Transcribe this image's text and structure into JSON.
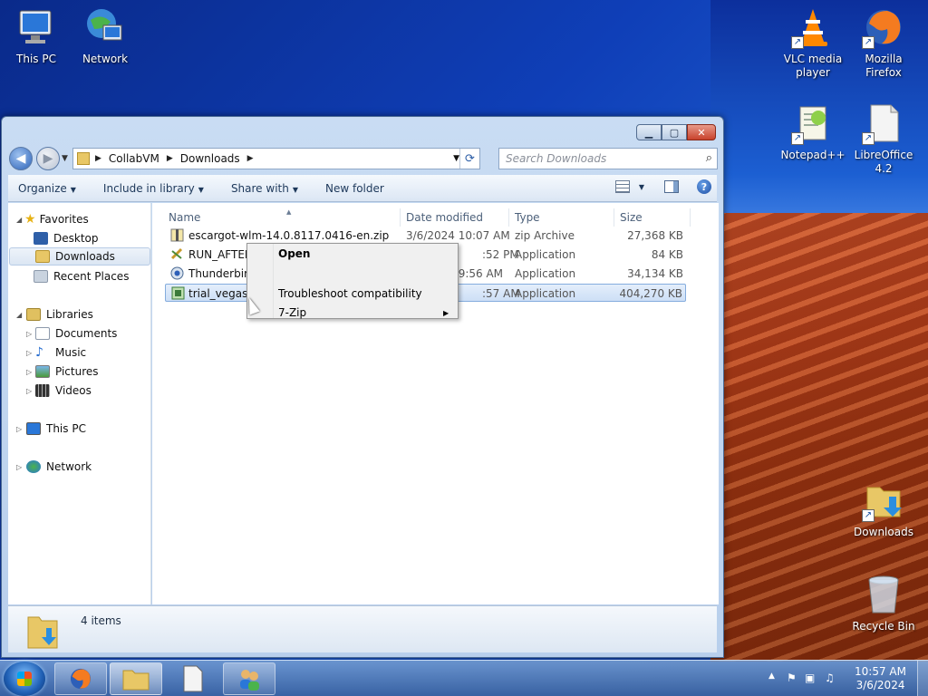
{
  "desktop": {
    "icons_left": [
      {
        "label": "This PC",
        "icon": "computer-icon"
      },
      {
        "label": "Network",
        "icon": "network-globe-icon"
      }
    ],
    "icons_right": [
      {
        "label": "VLC media player",
        "icon": "vlc-cone-icon"
      },
      {
        "label": "Mozilla Firefox",
        "icon": "firefox-icon"
      },
      {
        "label": "Notepad++",
        "icon": "notepadpp-icon"
      },
      {
        "label": "LibreOffice 4.2",
        "icon": "libreoffice-icon"
      },
      {
        "label": "Downloads",
        "icon": "downloads-folder-icon"
      },
      {
        "label": "Recycle Bin",
        "icon": "recycle-bin-icon"
      }
    ]
  },
  "window": {
    "address": {
      "segments": [
        "CollabVM",
        "Downloads"
      ]
    },
    "search_placeholder": "Search Downloads",
    "toolbar": {
      "organize": "Organize",
      "include_in_library": "Include in library",
      "share_with": "Share with",
      "new_folder": "New folder"
    },
    "nav": {
      "favorites": "Favorites",
      "desktop": "Desktop",
      "downloads": "Downloads",
      "recent_places": "Recent Places",
      "libraries": "Libraries",
      "documents": "Documents",
      "music": "Music",
      "pictures": "Pictures",
      "videos": "Videos",
      "this_pc": "This PC",
      "network": "Network"
    },
    "columns": {
      "name": "Name",
      "date": "Date modified",
      "type": "Type",
      "size": "Size"
    },
    "files": [
      {
        "name": "escargot-wlm-14.0.8117.0416-en.zip",
        "date": "3/6/2024 10:07 AM",
        "type": "zip Archive",
        "size": "27,368 KB"
      },
      {
        "name": "RUN_AFTER_",
        "date": ":52 PM",
        "type": "Application",
        "size": "84 KB"
      },
      {
        "name": "Thunderbird Setup 45.0.exe",
        "date": "3/6/2024 9:56 AM",
        "type": "Application",
        "size": "34,134 KB"
      },
      {
        "name": "trial_vegaspr",
        "date": ":57 AM",
        "type": "Application",
        "size": "404,270 KB"
      }
    ],
    "status": {
      "item_count": "4 items"
    }
  },
  "context_menu": {
    "items": [
      {
        "label": "Open",
        "bold": true
      },
      {
        "label": "Troubleshoot compatibility"
      },
      {
        "label": "7-Zip",
        "submenu": true
      }
    ]
  },
  "taskbar": {
    "clock_time": "10:57 AM",
    "clock_date": "3/6/2024"
  },
  "colors": {
    "selection": "#cddff6",
    "window_frame": "#c9dcf3",
    "desert": "#b5401c"
  }
}
